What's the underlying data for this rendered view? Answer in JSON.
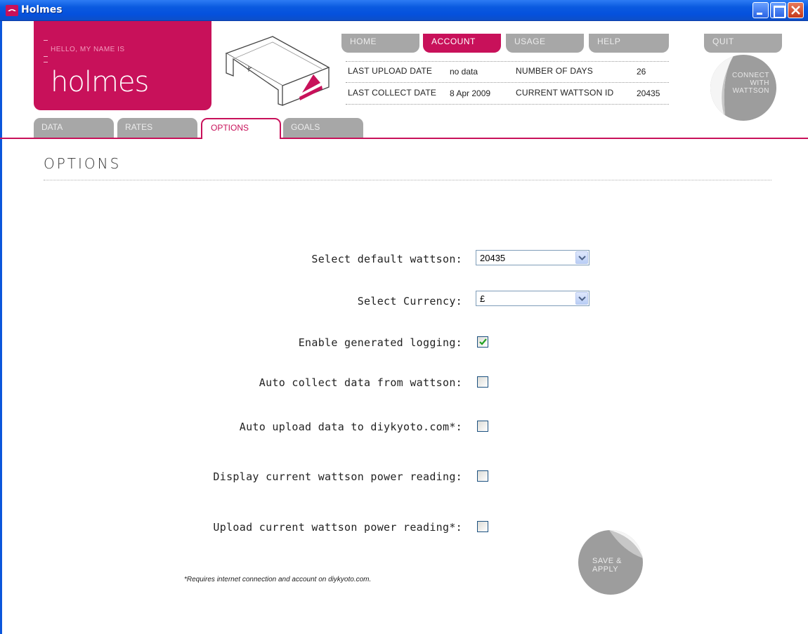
{
  "window": {
    "title": "Holmes"
  },
  "header": {
    "hello_label": "HELLO, MY NAME IS",
    "brand_name": "holmes",
    "nav": [
      {
        "label": "HOME",
        "active": false
      },
      {
        "label": "ACCOUNT",
        "active": true
      },
      {
        "label": "USAGE",
        "active": false
      },
      {
        "label": "HELP",
        "active": false
      },
      {
        "label": "QUIT",
        "active": false
      }
    ],
    "info": {
      "last_upload_label": "LAST UPLOAD DATE",
      "last_upload_value": "no data",
      "last_collect_label": "LAST COLLECT DATE",
      "last_collect_value": "8 Apr 2009",
      "num_days_label": "NUMBER OF DAYS",
      "num_days_value": "26",
      "wattson_id_label": "CURRENT WATTSON ID",
      "wattson_id_value": "20435"
    },
    "connect_button": "CONNECT\nWITH\nWATTSON"
  },
  "subtabs": [
    {
      "label": "DATA",
      "active": false
    },
    {
      "label": "RATES",
      "active": false
    },
    {
      "label": "OPTIONS",
      "active": true
    },
    {
      "label": "GOALS",
      "active": false
    }
  ],
  "options": {
    "title": "OPTIONS",
    "default_wattson_label": "Select default wattson:",
    "default_wattson_value": "20435",
    "currency_label": "Select Currency:",
    "currency_value": "£",
    "generated_logging_label": "Enable generated logging:",
    "generated_logging_checked": true,
    "auto_collect_label": "Auto collect data from wattson:",
    "auto_collect_checked": false,
    "auto_upload_label": "Auto upload data to diykyoto.com*:",
    "auto_upload_checked": false,
    "display_power_label": "Display current wattson power reading:",
    "display_power_checked": false,
    "upload_power_label": "Upload current wattson power reading*:",
    "upload_power_checked": false,
    "footnote": "*Requires internet connection and account on diykyoto.com.",
    "save_button": "SAVE &\nAPPLY"
  },
  "colors": {
    "accent": "#c8115a",
    "tab_grey": "#a7a7a7",
    "titlebar": "#0a5ae0"
  }
}
